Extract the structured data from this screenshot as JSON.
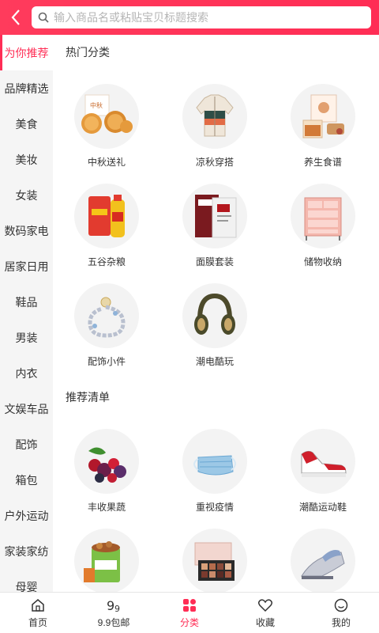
{
  "header": {
    "back_icon": "chevron-left-icon",
    "search_icon": "search-icon",
    "search_placeholder": "输入商品名或粘贴宝贝标题搜索"
  },
  "sidebar": {
    "items": [
      {
        "label": "为你推荐",
        "active": true
      },
      {
        "label": "品牌精选"
      },
      {
        "label": "美食"
      },
      {
        "label": "美妆"
      },
      {
        "label": "女装"
      },
      {
        "label": "数码家电"
      },
      {
        "label": "居家日用"
      },
      {
        "label": "鞋品"
      },
      {
        "label": "男装"
      },
      {
        "label": "内衣"
      },
      {
        "label": "文娱车品"
      },
      {
        "label": "配饰"
      },
      {
        "label": "箱包"
      },
      {
        "label": "户外运动"
      },
      {
        "label": "家装家纺"
      },
      {
        "label": "母婴"
      }
    ]
  },
  "sections": {
    "hot": {
      "title": "热门分类",
      "items": [
        {
          "label": "中秋送礼",
          "icon": "mooncake-icon"
        },
        {
          "label": "凉秋穿搭",
          "icon": "jacket-icon"
        },
        {
          "label": "养生食谱",
          "icon": "tea-icon"
        },
        {
          "label": "五谷杂粮",
          "icon": "rice-oil-icon"
        },
        {
          "label": "面膜套装",
          "icon": "face-mask-icon"
        },
        {
          "label": "储物收纳",
          "icon": "storage-drawer-icon"
        },
        {
          "label": "配饰小件",
          "icon": "bracelet-icon"
        },
        {
          "label": "潮电酷玩",
          "icon": "headphones-icon"
        }
      ]
    },
    "recommend": {
      "title": "推荐清单",
      "items": [
        {
          "label": "丰收果蔬",
          "icon": "fruit-icon"
        },
        {
          "label": "重视疫情",
          "icon": "medical-mask-icon"
        },
        {
          "label": "潮酷运动鞋",
          "icon": "sneaker-icon"
        },
        {
          "label": "",
          "icon": "snack-bucket-icon"
        },
        {
          "label": "",
          "icon": "eyeshadow-palette-icon"
        },
        {
          "label": "",
          "icon": "iron-icon"
        }
      ]
    }
  },
  "tabbar": {
    "items": [
      {
        "label": "首页",
        "icon": "home-icon"
      },
      {
        "label": "9.9包邮",
        "icon": "nine-nine-icon"
      },
      {
        "label": "分类",
        "icon": "category-icon",
        "active": true
      },
      {
        "label": "收藏",
        "icon": "heart-icon"
      },
      {
        "label": "我的",
        "icon": "profile-icon"
      }
    ]
  },
  "colors": {
    "accent": "#ff2d55",
    "header_bg": "#ff3b5c"
  }
}
